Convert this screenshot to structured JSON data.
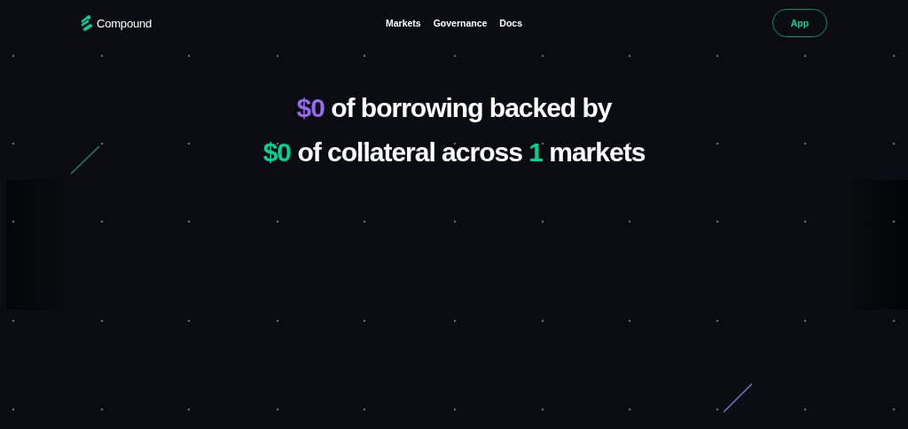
{
  "header": {
    "brand": "Compound",
    "nav": [
      "Markets",
      "Governance",
      "Docs"
    ],
    "app_button": "App"
  },
  "headline": [
    {
      "segments": [
        {
          "text": "$0",
          "color": "#9669ed"
        },
        {
          "text": "of borrowing backed by"
        }
      ]
    },
    {
      "segments": [
        {
          "text": "$0",
          "color": "#00d395"
        },
        {
          "text": "of collateral across"
        },
        {
          "text": "1",
          "color": "#00d395"
        },
        {
          "text": "markets"
        }
      ]
    }
  ]
}
